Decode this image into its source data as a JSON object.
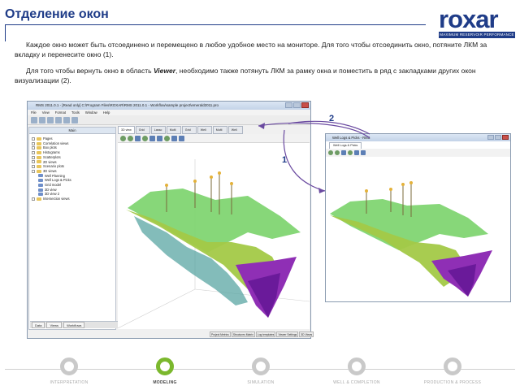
{
  "header": {
    "title": "Отделение окон",
    "logo_text": "roxar",
    "logo_tagline": "MAXIMUM RESERVOIR PERFORMANCE"
  },
  "body": {
    "paragraph_1": "Каждое окно может быть отсоединено и перемещено в любое удобное место на мониторе. Для того чтобы отсоединить окно, потяните ЛКМ за вкладку и перенесите окно (1).",
    "paragraph_2_start": "Для того чтобы вернуть окно в область ",
    "paragraph_2_bold": "Viewer",
    "paragraph_2_end": ", необходимо также потянуть ЛКМ за рамку окна и поместить в ряд с закладками других окон визуализации (2)."
  },
  "app_window": {
    "title": "RMS 2011.0.1 - [Read only] C:\\Program Files\\ROXAR\\RMS 2011.0.1 - Workflow\\sample project\\emerald2011.pro",
    "menu": [
      "File",
      "View",
      "Format",
      "Tools",
      "Window",
      "Help"
    ],
    "left_panel_title": "Main",
    "tree": [
      {
        "label": "Pages",
        "indent": false
      },
      {
        "label": "Correlation views",
        "indent": false
      },
      {
        "label": "Box plots",
        "indent": false
      },
      {
        "label": "Histograms",
        "indent": false
      },
      {
        "label": "Scatterplots",
        "indent": false
      },
      {
        "label": "2D views",
        "indent": false
      },
      {
        "label": "Scenario plots",
        "indent": false
      },
      {
        "label": "3D views",
        "indent": false
      },
      {
        "label": "Well Planning",
        "indent": true
      },
      {
        "label": "Well Logs & Picks",
        "indent": true
      },
      {
        "label": "Grid model",
        "indent": true
      },
      {
        "label": "3D view",
        "indent": true
      },
      {
        "label": "3D view 2",
        "indent": true
      },
      {
        "label": "Intersection views",
        "indent": false
      }
    ],
    "left_tabs": [
      "Data",
      "Views",
      "Workflows"
    ],
    "view_tabs": [
      "3D view",
      "Grid",
      "Lasso",
      "Multi",
      "Grid",
      "Well",
      "Multi",
      "Well"
    ],
    "bottom_tabs": [
      "Project Metrics",
      "Structures Matrix",
      "Log templates",
      "Viewer Settings",
      "3D Views"
    ]
  },
  "floating_window": {
    "title": "Well Logs & Picks - RMS",
    "tab": "Well Logs & Picks"
  },
  "step_labels": {
    "one": "1",
    "two": "2"
  },
  "process_steps": [
    {
      "label": "INTERPRETATION",
      "active": false
    },
    {
      "label": "MODELING",
      "active": true
    },
    {
      "label": "SIMULATION",
      "active": false
    },
    {
      "label": "WELL & COMPLETION",
      "active": false
    },
    {
      "label": "PRODUCTION & PROCESS",
      "active": false
    }
  ],
  "colors": {
    "brand_blue": "#1f3c88",
    "active_green": "#7bb82d",
    "inactive_grey": "#c9c9c9"
  }
}
